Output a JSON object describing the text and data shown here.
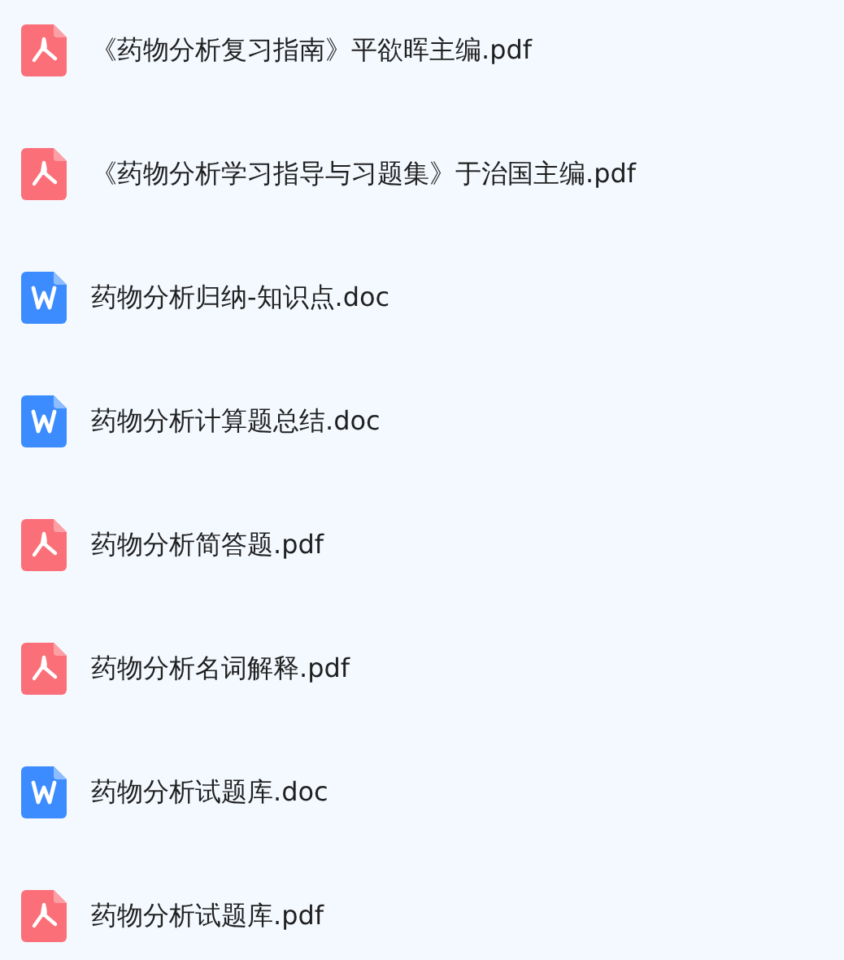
{
  "files": [
    {
      "kind": "pdf",
      "name": "《药物分析复习指南》平欲晖主编.pdf"
    },
    {
      "kind": "pdf",
      "name": "《药物分析学习指导与习题集》于治国主编.pdf"
    },
    {
      "kind": "doc",
      "name": "药物分析归纳-知识点.doc"
    },
    {
      "kind": "doc",
      "name": "药物分析计算题总结.doc"
    },
    {
      "kind": "pdf",
      "name": "药物分析简答题.pdf"
    },
    {
      "kind": "pdf",
      "name": "药物分析名词解释.pdf"
    },
    {
      "kind": "doc",
      "name": "药物分析试题库.doc"
    },
    {
      "kind": "pdf",
      "name": "药物分析试题库.pdf"
    }
  ]
}
